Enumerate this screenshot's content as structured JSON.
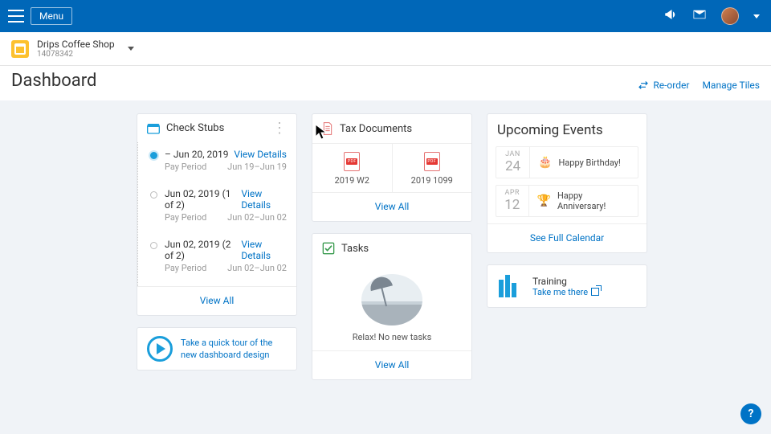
{
  "topbar": {
    "menu_label": "Menu"
  },
  "company": {
    "name": "Drips Coffee Shop",
    "id": "14078342"
  },
  "page": {
    "title": "Dashboard",
    "reorder": "Re-order",
    "manage": "Manage Tiles"
  },
  "stubs": {
    "title": "Check Stubs",
    "items": [
      {
        "date": "Jun 20, 2019",
        "label": "Pay Period",
        "range": "Jun 19–Jun 19",
        "link": "View Details"
      },
      {
        "date": "Jun 02, 2019 (1 of 2)",
        "label": "Pay Period",
        "range": "Jun 02–Jun 02",
        "link": "View Details"
      },
      {
        "date": "Jun 02, 2019 (2 of 2)",
        "label": "Pay Period",
        "range": "Jun 02–Jun 02",
        "link": "View Details"
      }
    ],
    "view_all": "View All"
  },
  "tour": {
    "text": "Take a quick tour of the new dashboard design"
  },
  "tax": {
    "title": "Tax Documents",
    "docs": [
      {
        "label": "2019 W2"
      },
      {
        "label": "2019 1099"
      }
    ],
    "view_all": "View All"
  },
  "tasks": {
    "title": "Tasks",
    "empty": "Relax! No new tasks",
    "view_all": "View All"
  },
  "upcoming": {
    "title": "Upcoming Events",
    "events": [
      {
        "month": "JAN",
        "day": "24",
        "label": "Happy Birthday!"
      },
      {
        "month": "APR",
        "day": "12",
        "label": "Happy Anniversary!"
      }
    ],
    "see_all": "See Full Calendar"
  },
  "training": {
    "title": "Training",
    "link": "Take me there"
  },
  "help": "?"
}
